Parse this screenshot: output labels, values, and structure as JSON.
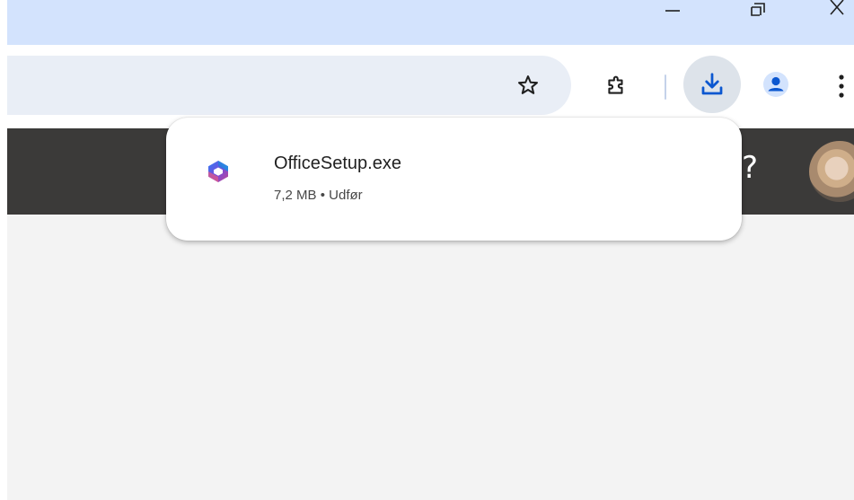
{
  "window_controls": {
    "minimize_icon": "minimize-icon",
    "maximize_icon": "restore-icon",
    "close_icon": "close-icon"
  },
  "toolbar": {
    "icons": [
      "star-icon",
      "puzzle-extensions-icon",
      "download-icon",
      "profile-icon",
      "more-vert-icon"
    ],
    "accent_color": "#0b57d0"
  },
  "page_header": {
    "help_glyph": "?",
    "background_color": "#3b3a39"
  },
  "download_bubble": {
    "file_name": "OfficeSetup.exe",
    "file_size": "7,2 MB",
    "separator": "•",
    "status": "Udfør",
    "file_icon": "microsoft-365-icon"
  }
}
